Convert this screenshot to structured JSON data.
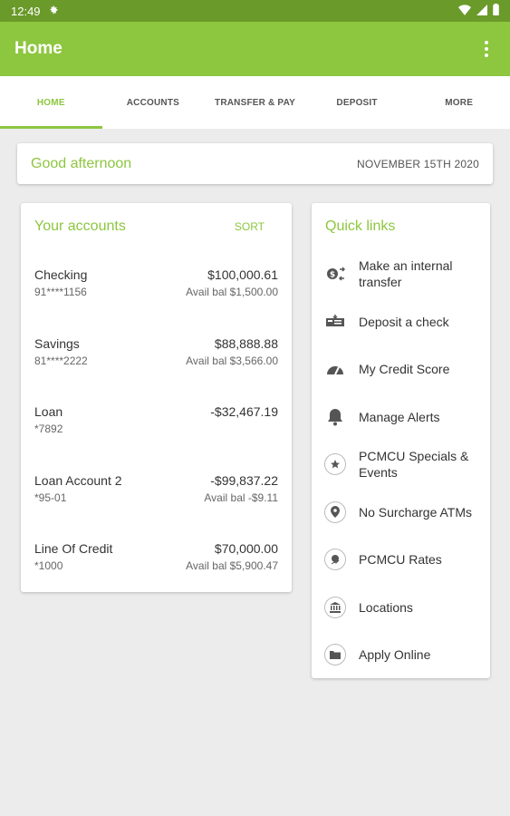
{
  "status_bar": {
    "time": "12:49"
  },
  "app_bar": {
    "title": "Home"
  },
  "tabs": [
    {
      "label": "HOME",
      "active": true
    },
    {
      "label": "ACCOUNTS"
    },
    {
      "label": "TRANSFER & PAY"
    },
    {
      "label": "DEPOSIT"
    },
    {
      "label": "MORE"
    }
  ],
  "greeting": {
    "text": "Good afternoon",
    "date": "NOVEMBER 15TH 2020"
  },
  "accounts": {
    "title": "Your accounts",
    "sort_label": "SORT",
    "items": [
      {
        "name": "Checking",
        "number": "91****1156",
        "balance": "$100,000.61",
        "available": "Avail bal $1,500.00"
      },
      {
        "name": "Savings",
        "number": "81****2222",
        "balance": "$88,888.88",
        "available": "Avail bal $3,566.00"
      },
      {
        "name": "Loan",
        "number": "*7892",
        "balance": "-$32,467.19",
        "available": ""
      },
      {
        "name": "Loan Account 2",
        "number": "*95-01",
        "balance": "-$99,837.22",
        "available": "Avail bal -$9.11"
      },
      {
        "name": "Line Of Credit",
        "number": "*1000",
        "balance": "$70,000.00",
        "available": "Avail bal $5,900.47"
      }
    ]
  },
  "quick_links": {
    "title": "Quick links",
    "items": [
      {
        "label": "Make an internal transfer",
        "icon": "transfer-icon"
      },
      {
        "label": "Deposit a check",
        "icon": "check-deposit-icon"
      },
      {
        "label": "My Credit Score",
        "icon": "gauge-icon"
      },
      {
        "label": "Manage Alerts",
        "icon": "bell-icon"
      },
      {
        "label": "PCMCU Specials & Events",
        "icon": "star-icon"
      },
      {
        "label": "No Surcharge ATMs",
        "icon": "location-pin-icon"
      },
      {
        "label": "PCMCU Rates",
        "icon": "rates-icon"
      },
      {
        "label": "Locations",
        "icon": "bank-icon"
      },
      {
        "label": "Apply Online",
        "icon": "folder-icon"
      }
    ]
  },
  "colors": {
    "accent": "#8dc63f",
    "status_bar": "#6a9a2a",
    "background": "#ececec"
  }
}
